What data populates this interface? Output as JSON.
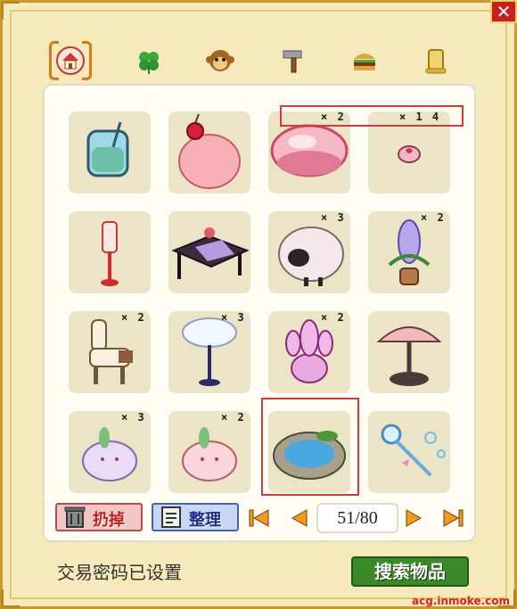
{
  "tabs": [
    {
      "name": "house",
      "active": true
    },
    {
      "name": "clover"
    },
    {
      "name": "monkey"
    },
    {
      "name": "hammer"
    },
    {
      "name": "burger"
    },
    {
      "name": "scroll"
    }
  ],
  "close_label": "✕",
  "items": [
    {
      "icon": "juice-cup-icon",
      "qty": ""
    },
    {
      "icon": "cherry-dome-icon",
      "qty": ""
    },
    {
      "icon": "pink-fluffy-bush-icon",
      "qty": "× 2"
    },
    {
      "icon": "pink-heart-candle-icon",
      "qty": "× 1 4"
    },
    {
      "icon": "standing-lamp-icon",
      "qty": ""
    },
    {
      "icon": "dining-table-icon",
      "qty": ""
    },
    {
      "icon": "sheep-icon",
      "qty": "× 3"
    },
    {
      "icon": "hyacinth-pot-icon",
      "qty": "× 2"
    },
    {
      "icon": "alpaca-icon",
      "qty": "× 2"
    },
    {
      "icon": "cloud-lamp-icon",
      "qty": "× 3"
    },
    {
      "icon": "lotus-icon",
      "qty": "× 2"
    },
    {
      "icon": "mushroom-table-lamp-icon",
      "qty": ""
    },
    {
      "icon": "purple-bunny-mochi-icon",
      "qty": "× 3"
    },
    {
      "icon": "pink-bunny-mochi-icon",
      "qty": "× 2"
    },
    {
      "icon": "stone-pond-icon",
      "qty": ""
    },
    {
      "icon": "bubble-wand-icon",
      "qty": ""
    }
  ],
  "buttons": {
    "discard_label": "扔掉",
    "sort_label": "整理",
    "search_label": "搜索物品"
  },
  "pager": {
    "current": "51",
    "sep": "/",
    "total": "80"
  },
  "status_text": "交易密码已设置",
  "watermark": "acg.inmoke.com",
  "colors": {
    "frame": "#c99a2c",
    "panel_bg": "#fffdf4",
    "slot_bg": "#ebe4c6",
    "highlight": "#d43a3a",
    "search_green": "#3a8a2a"
  }
}
